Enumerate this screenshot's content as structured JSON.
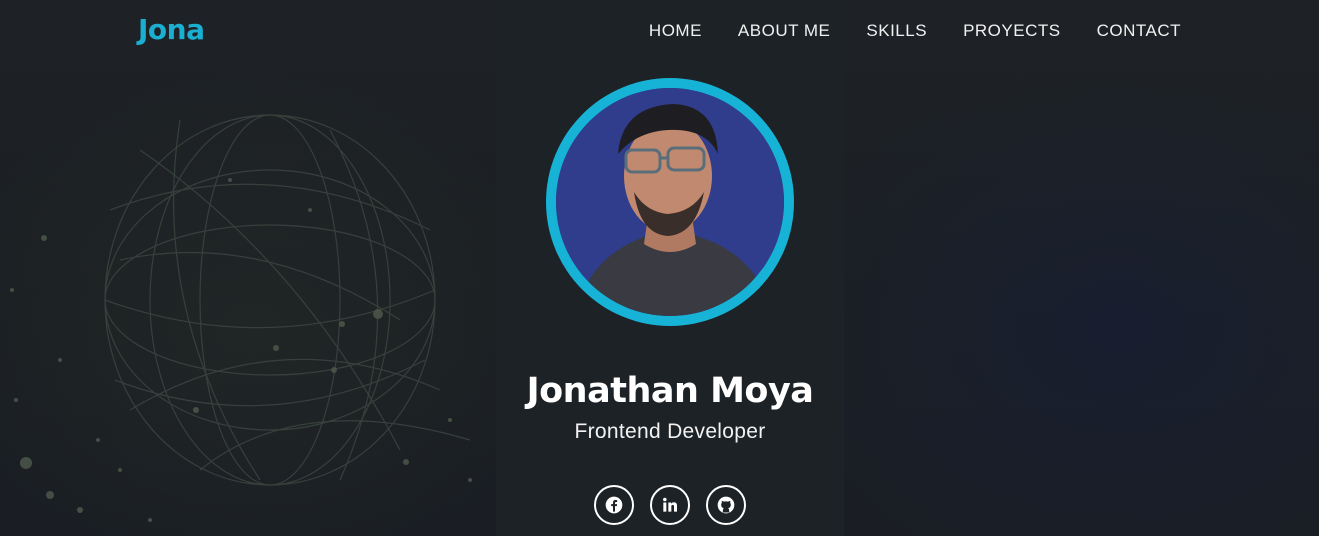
{
  "header": {
    "logo": "Jona",
    "nav": [
      {
        "label": "HOME"
      },
      {
        "label": "ABOUT ME"
      },
      {
        "label": "SKILLS"
      },
      {
        "label": "PROYECTS"
      },
      {
        "label": "CONTACT"
      }
    ]
  },
  "profile": {
    "name": "Jonathan Moya",
    "role": "Frontend Developer",
    "avatar_icon": "profile-photo",
    "ring_color": "#17b3d6",
    "photo_bg_color": "#2e3e8e"
  },
  "socials": [
    {
      "icon": "facebook-icon"
    },
    {
      "icon": "linkedin-icon"
    },
    {
      "icon": "github-icon"
    }
  ],
  "colors": {
    "accent": "#1aafd0",
    "background": "#1c2024",
    "text": "#ffffff"
  }
}
